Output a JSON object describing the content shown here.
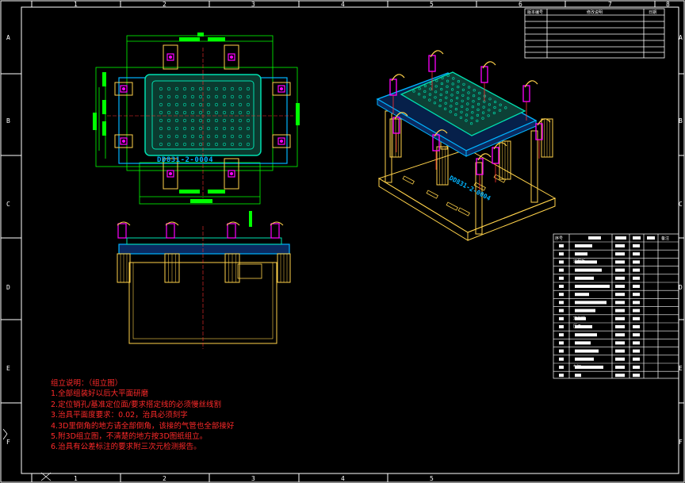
{
  "drawing": {
    "part_code_top": "DD831-2-0004",
    "part_code_iso": "DD831-2-0004",
    "border": {
      "columns": [
        "1",
        "2",
        "3",
        "4",
        "5",
        "6",
        "7",
        "8"
      ],
      "rows": [
        "A",
        "B",
        "C",
        "D",
        "E",
        "F"
      ]
    }
  },
  "revision_table": {
    "headers": [
      "版本编号",
      "修改说明",
      "日期"
    ]
  },
  "bom": {
    "headers": [
      "序号",
      "",
      "",
      "",
      "",
      "备注"
    ],
    "rows": [
      {
        "label": ""
      },
      {
        "label": ""
      },
      {
        "label": "过程板"
      },
      {
        "label": ""
      },
      {
        "label": ""
      },
      {
        "label": ""
      },
      {
        "label": ""
      },
      {
        "label": ""
      },
      {
        "label": ""
      },
      {
        "label": "定位销"
      },
      {
        "label": "压爪"
      },
      {
        "label": ""
      },
      {
        "label": ""
      },
      {
        "label": ""
      },
      {
        "label": ""
      },
      {
        "label": "气缸"
      },
      {
        "label": ""
      }
    ]
  },
  "notes": {
    "title": "组立说明：（组立图）",
    "lines": [
      "1.全部组装好以后大平面研磨",
      "2.定位销孔/基准定位面/要求搭定线的必须慢丝线割",
      "3.治具平面度要求：0.02，治具必须刻字",
      "4.3D里倒角的地方请全部倒角，该接的气管也全部接好",
      "5.附3D组立图，不清楚的地方按3D图纸组立。",
      "6.治具有公差标注的要求附三次元检测报告。"
    ]
  },
  "colors": {
    "frame": "#ffffff",
    "dimension": "#00ff00",
    "fixture": "#00e0b0",
    "pin": "#ff00ff",
    "cylinder": "#ffd24a",
    "plate": "#00b4ff",
    "notes": "#ff2a2a"
  }
}
